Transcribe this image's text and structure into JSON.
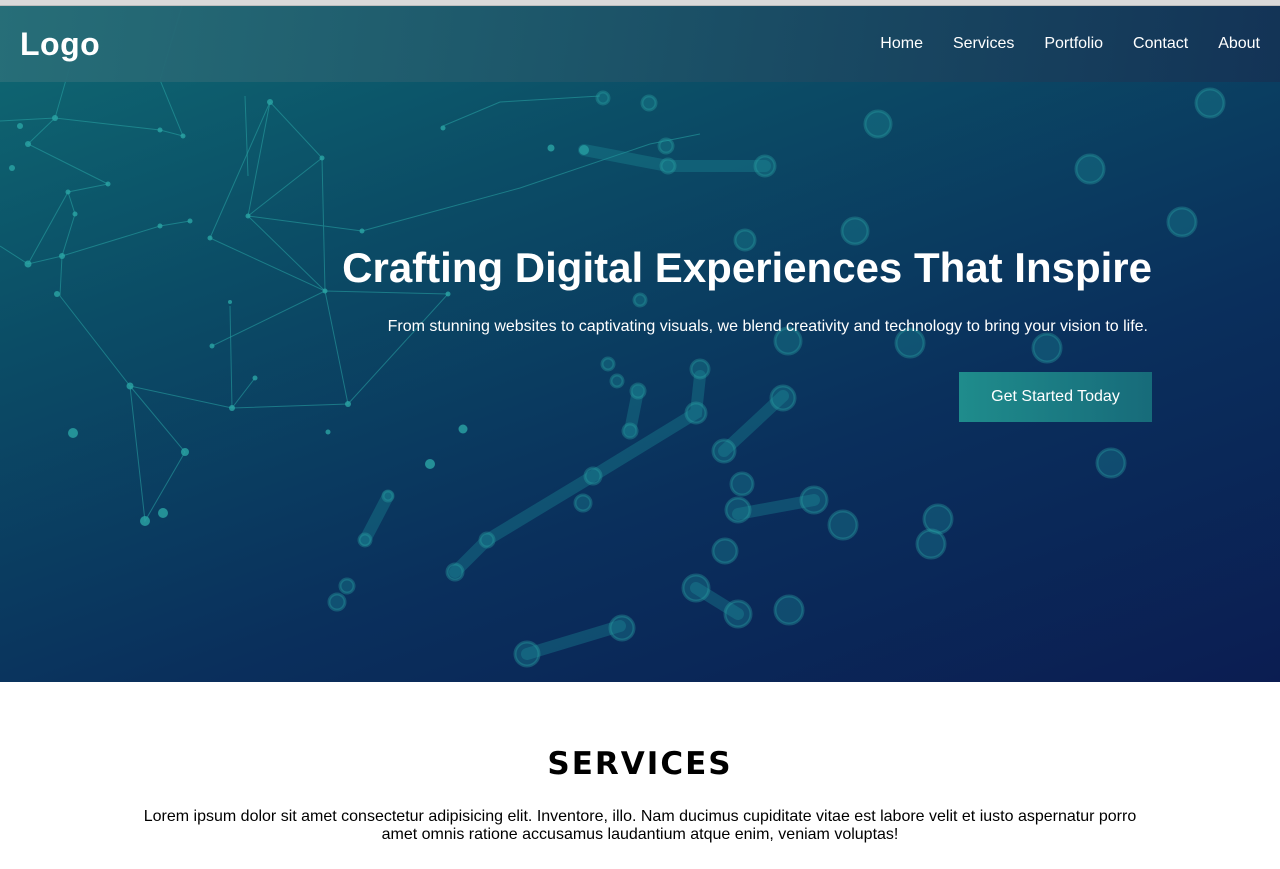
{
  "navbar": {
    "logo": "Logo",
    "links": [
      "Home",
      "Services",
      "Portfolio",
      "Contact",
      "About"
    ]
  },
  "hero": {
    "title": "Crafting Digital Experiences That Inspire",
    "subtitle": "From stunning websites to captivating visuals, we blend creativity and technology to bring your vision to life.",
    "cta_label": "Get Started Today"
  },
  "services": {
    "title": "SERVICES",
    "text": "Lorem ipsum dolor sit amet consectetur adipisicing elit. Inventore, illo. Nam ducimus cupiditate vitae est labore velit et iusto aspernatur porro amet omnis ratione accusamus laudantium atque enim, veniam voluptas!"
  },
  "colors": {
    "hero_start": "#0f6a73",
    "hero_end": "#0b1d52",
    "button": "#1f8c8c",
    "accent_node": "#2aa5a5"
  }
}
